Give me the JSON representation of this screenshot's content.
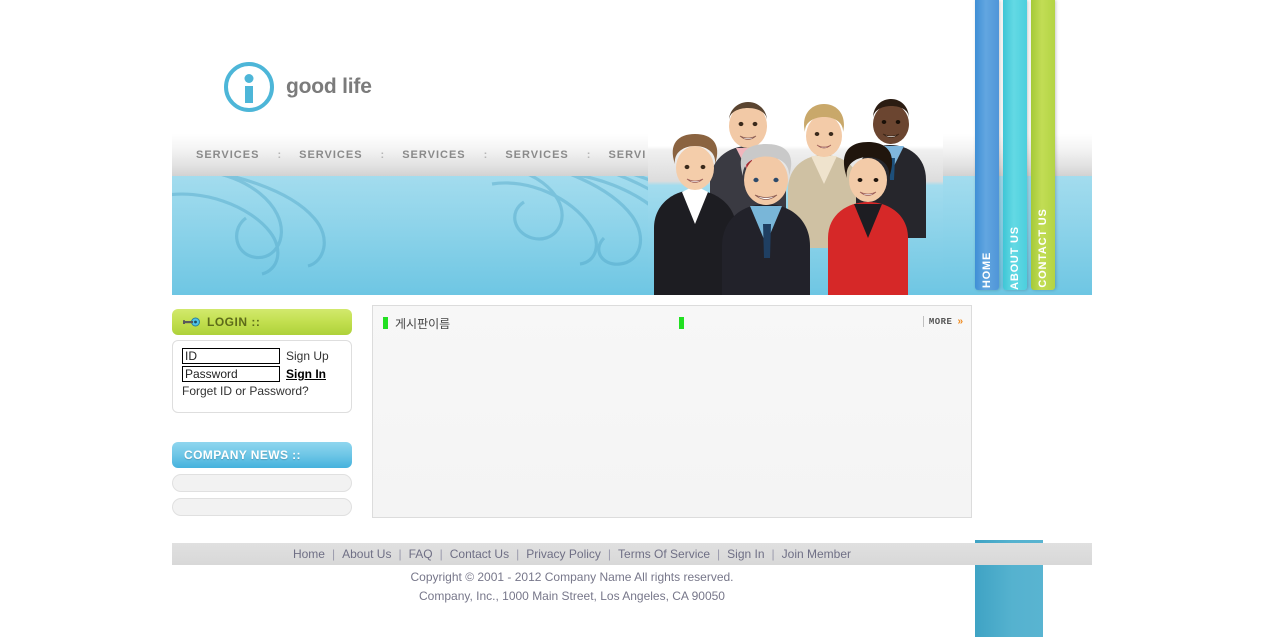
{
  "site": {
    "logo_text": "good life",
    "logo_icon": "info-circle-icon"
  },
  "topnav": {
    "items": [
      {
        "label": "SERVICES"
      },
      {
        "label": "SERVICES"
      },
      {
        "label": "SERVICES"
      },
      {
        "label": "SERVICES"
      },
      {
        "label": "SERVI"
      }
    ],
    "separator": ":"
  },
  "side_tabs": [
    {
      "label": "HOME",
      "color": "#4f95d8"
    },
    {
      "label": "ABOUT US",
      "color": "#4ccfdd"
    },
    {
      "label": "CONTACT US",
      "color": "#b3d444"
    }
  ],
  "login": {
    "header_label": "LOGIN  ::",
    "header_icon": "key-icon",
    "id_value": "ID",
    "id_placeholder": "ID",
    "password_value": "Password",
    "password_placeholder": "Password",
    "signup_label": "Sign Up",
    "signin_label": "Sign In",
    "forget_label": "Forget ID or Password?"
  },
  "company_news": {
    "header_label": "COMPANY NEWS  ::",
    "rows": [
      "",
      ""
    ]
  },
  "board": {
    "title": "게시판이름",
    "more_label": "MORE",
    "more_chevron": "»",
    "bullet_color": "#22e022"
  },
  "footer": {
    "links": [
      "Home",
      "About Us",
      "FAQ",
      "Contact Us",
      "Privacy Policy",
      "Terms Of Service",
      "Sign In",
      "Join Member"
    ],
    "separator": "|",
    "copyright_line1": "Copyright © 2001 - 2012 Company Name All rights reserved.",
    "copyright_line2": "Company, Inc., 1000 Main Street, Los Angeles, CA 90050"
  }
}
